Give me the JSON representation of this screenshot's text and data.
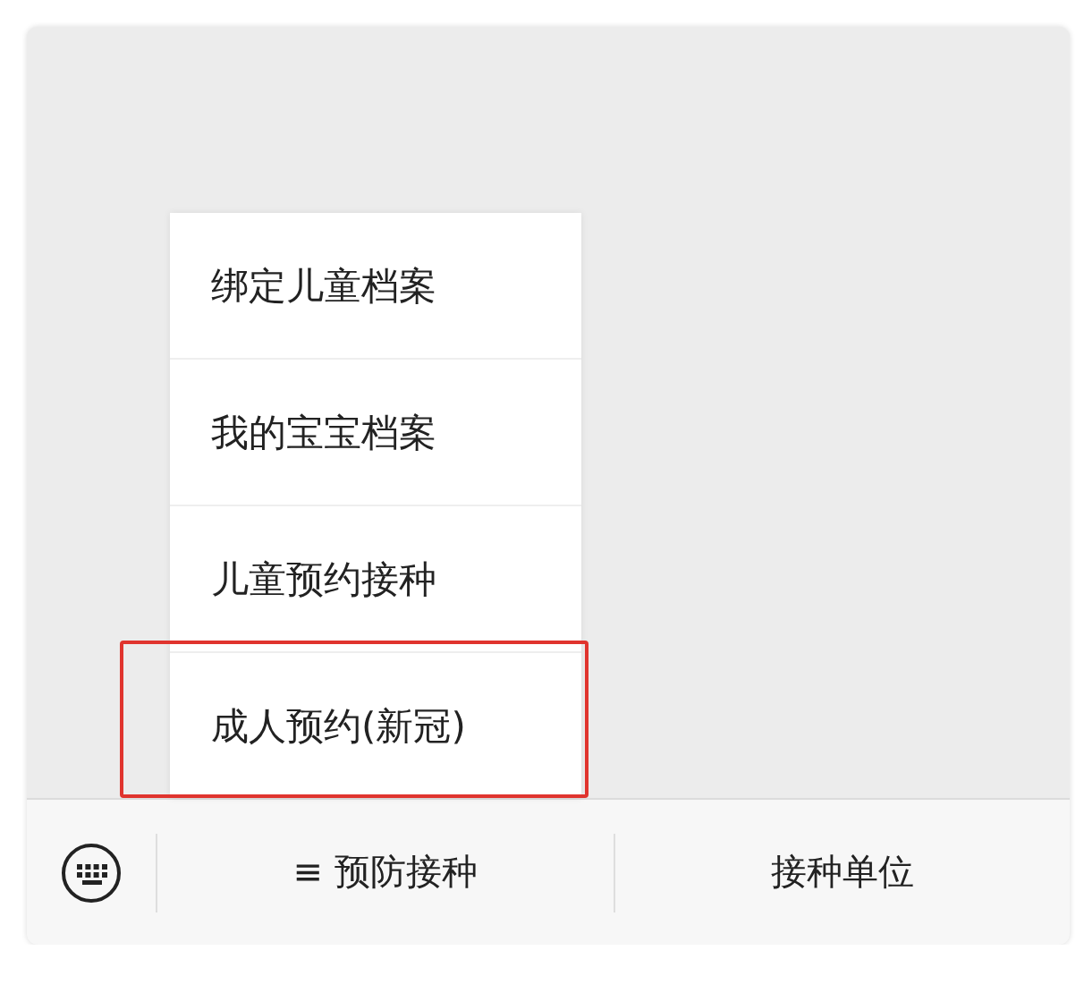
{
  "popup_menu": {
    "items": [
      {
        "label": "绑定儿童档案",
        "highlighted": false
      },
      {
        "label": "我的宝宝档案",
        "highlighted": false
      },
      {
        "label": "儿童预约接种",
        "highlighted": false
      },
      {
        "label": "成人预约(新冠)",
        "highlighted": true
      }
    ]
  },
  "bottom_bar": {
    "buttons": [
      {
        "label": "≡ 预防接种"
      },
      {
        "label": "接种单位"
      }
    ]
  }
}
